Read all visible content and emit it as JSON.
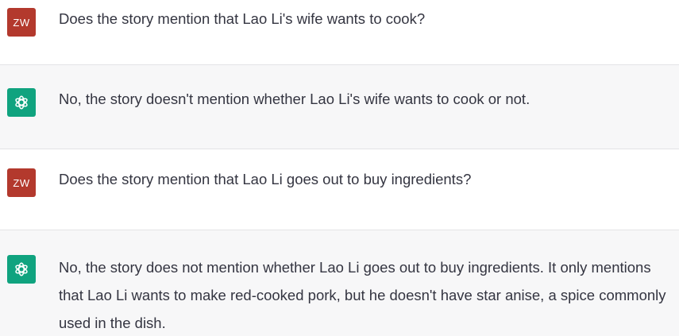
{
  "conversation": {
    "messages": [
      {
        "role": "user",
        "avatar_text": "ZW",
        "text": "Does the story mention that Lao Li's wife wants to cook?"
      },
      {
        "role": "assistant",
        "avatar_icon": "openai-logo-icon",
        "text": "No, the story doesn't mention whether Lao Li's wife wants to cook or not."
      },
      {
        "role": "user",
        "avatar_text": "ZW",
        "text": "Does the story mention that Lao Li goes out to buy ingredients?"
      },
      {
        "role": "assistant",
        "avatar_icon": "openai-logo-icon",
        "text": "No, the story does not mention whether Lao Li goes out to buy ingredients. It only mentions that Lao Li wants to make red-cooked pork, but he doesn't have star anise, a spice commonly used in the dish."
      }
    ]
  },
  "colors": {
    "user_avatar_bg": "#b3392d",
    "assistant_avatar_bg": "#10a37f",
    "assistant_row_bg": "#f7f7f8",
    "text": "#343541"
  }
}
